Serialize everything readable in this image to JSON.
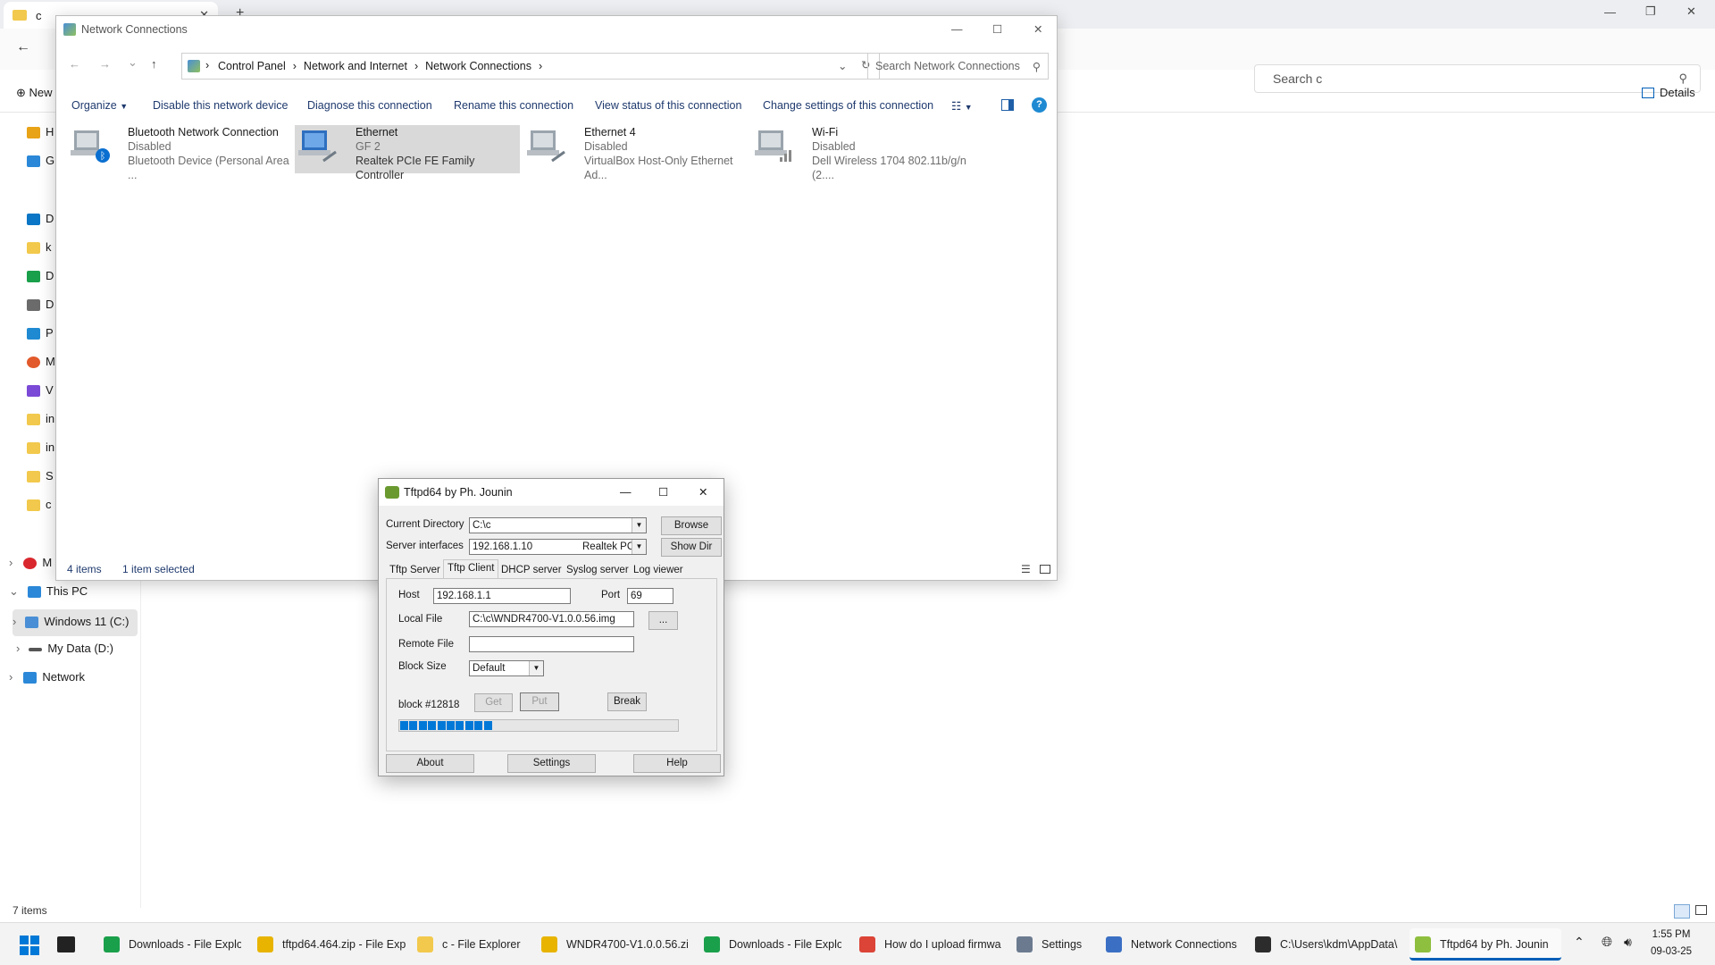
{
  "bg_explorer": {
    "tab_title": "c",
    "search_placeholder": "Search c",
    "new_label": "New",
    "details_label": "Details",
    "nav": [
      {
        "label": "H",
        "color": "#e8a317"
      },
      {
        "label": "G",
        "color": "#2b88d8"
      },
      {
        "label": "D",
        "color": "#0b76c5"
      },
      {
        "label": "k",
        "color": "#f2c94c"
      },
      {
        "label": "D",
        "color": "#1a9f4a"
      },
      {
        "label": "D",
        "color": "#6b6b6b"
      },
      {
        "label": "P",
        "color": "#1f8ad2"
      },
      {
        "label": "M",
        "color": "#e25a2b"
      },
      {
        "label": "V",
        "color": "#7b4ad6"
      },
      {
        "label": "in",
        "color": "#f2c94c"
      },
      {
        "label": "in",
        "color": "#f2c94c"
      },
      {
        "label": "S",
        "color": "#f2c94c"
      },
      {
        "label": "c",
        "color": "#f2c94c"
      }
    ],
    "tree": {
      "m_label": "M",
      "this_pc": "This PC",
      "windows": "Windows 11 (C:)",
      "mydata": "My Data (D:)",
      "network": "Network"
    },
    "status": "7 items"
  },
  "nc_window": {
    "title": "Network Connections",
    "breadcrumb": [
      "Control Panel",
      "Network and Internet",
      "Network Connections"
    ],
    "search_placeholder": "Search Network Connections",
    "commands": [
      "Organize",
      "Disable this network device",
      "Diagnose this connection",
      "Rename this connection",
      "View status of this connection",
      "Change settings of this connection"
    ],
    "connections": [
      {
        "name": "Bluetooth Network Connection",
        "status": "Disabled",
        "device": "Bluetooth Device (Personal Area ..."
      },
      {
        "name": "Ethernet",
        "status": "GF 2",
        "device": "Realtek PCIe FE Family Controller"
      },
      {
        "name": "Ethernet 4",
        "status": "Disabled",
        "device": "VirtualBox Host-Only Ethernet Ad..."
      },
      {
        "name": "Wi-Fi",
        "status": "Disabled",
        "device": "Dell Wireless 1704 802.11b/g/n (2...."
      }
    ],
    "status_items": "4 items",
    "status_selected": "1 item selected"
  },
  "tftpd": {
    "title": "Tftpd64 by Ph. Jounin",
    "current_dir_label": "Current Directory",
    "current_dir": "C:\\c",
    "browse": "Browse",
    "server_if_label": "Server interfaces",
    "server_ip": "192.168.1.10",
    "server_if_name": "Realtek PC",
    "show_dir": "Show Dir",
    "tabs": [
      "Tftp Server",
      "Tftp Client",
      "DHCP server",
      "Syslog server",
      "Log viewer"
    ],
    "host_label": "Host",
    "host": "192.168.1.1",
    "port_label": "Port",
    "port": "69",
    "local_file_label": "Local File",
    "local_file": "C:\\c\\WNDR4700-V1.0.0.56.img",
    "ellipsis": "...",
    "remote_file_label": "Remote File",
    "remote_file": "",
    "block_size_label": "Block Size",
    "block_size": "Default",
    "get": "Get",
    "put": "Put",
    "break": "Break",
    "block_status": "block #12818",
    "progress_fraction": 0.34,
    "about": "About",
    "settings": "Settings",
    "help": "Help"
  },
  "taskbar": {
    "items": [
      {
        "label": "Downloads - File Explor",
        "color": "#1a9f4a"
      },
      {
        "label": "tftpd64.464.zip - File Exp",
        "color": "#e8b400"
      },
      {
        "label": "c - File Explorer",
        "color": "#f2c94c"
      },
      {
        "label": "WNDR4700-V1.0.0.56.zi",
        "color": "#e8b400"
      },
      {
        "label": "Downloads - File Explor",
        "color": "#1a9f4a"
      },
      {
        "label": "How do I upload firmwa",
        "color": "#db4437"
      },
      {
        "label": "Settings",
        "color": "#6b7a8f"
      },
      {
        "label": "Network Connections",
        "color": "#3a6fc4"
      },
      {
        "label": "C:\\Users\\kdm\\AppData\\",
        "color": "#2c2c2c"
      },
      {
        "label": "Tftpd64 by Ph. Jounin",
        "color": "#8fbf3f"
      }
    ],
    "time": "1:55 PM",
    "date": "09-03-25"
  },
  "colors": {
    "accent": "#0078d7",
    "link": "#1f3a6e",
    "selection": "#cce4f7"
  }
}
